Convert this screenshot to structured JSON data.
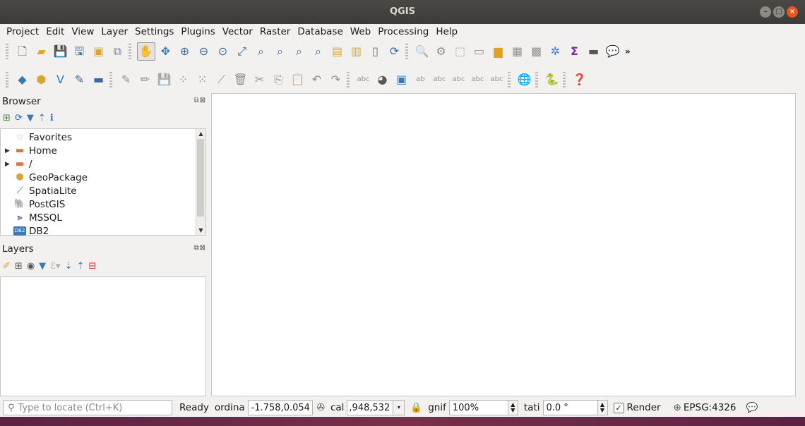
{
  "window": {
    "title": "QGIS"
  },
  "menubar": [
    "Project",
    "Edit",
    "View",
    "Layer",
    "Settings",
    "Plugins",
    "Vector",
    "Raster",
    "Database",
    "Web",
    "Processing",
    "Help"
  ],
  "browser": {
    "title": "Browser",
    "items": [
      {
        "label": "Favorites",
        "expandable": false,
        "icon": "star-icon"
      },
      {
        "label": "Home",
        "expandable": true,
        "icon": "folder-icon"
      },
      {
        "label": "/",
        "expandable": true,
        "icon": "folder-icon"
      },
      {
        "label": "GeoPackage",
        "expandable": false,
        "icon": "geopackage-icon"
      },
      {
        "label": "SpatiaLite",
        "expandable": false,
        "icon": "feather-icon"
      },
      {
        "label": "PostGIS",
        "expandable": false,
        "icon": "elephant-icon"
      },
      {
        "label": "MSSQL",
        "expandable": false,
        "icon": "mssql-icon"
      },
      {
        "label": "DB2",
        "expandable": false,
        "icon": "db2-icon"
      }
    ]
  },
  "layers": {
    "title": "Layers"
  },
  "statusbar": {
    "locator_placeholder": "Type to locate (Ctrl+K)",
    "status": "Ready",
    "coordinate_label": "ordinа",
    "coordinate_value": "-1.758,0.054",
    "scale_label": "cal",
    "scale_value": ",948,532",
    "magnifier_label": "gnif",
    "magnifier_value": "100%",
    "rotation_label": "tati",
    "rotation_value": "0.0 °",
    "render_label": "Render",
    "render_checked": true,
    "crs": "EPSG:4326"
  },
  "colors": {
    "accent_close": "#e9541f",
    "titlebar": "#3c3b37",
    "window_bg": "#f2f1f0"
  }
}
